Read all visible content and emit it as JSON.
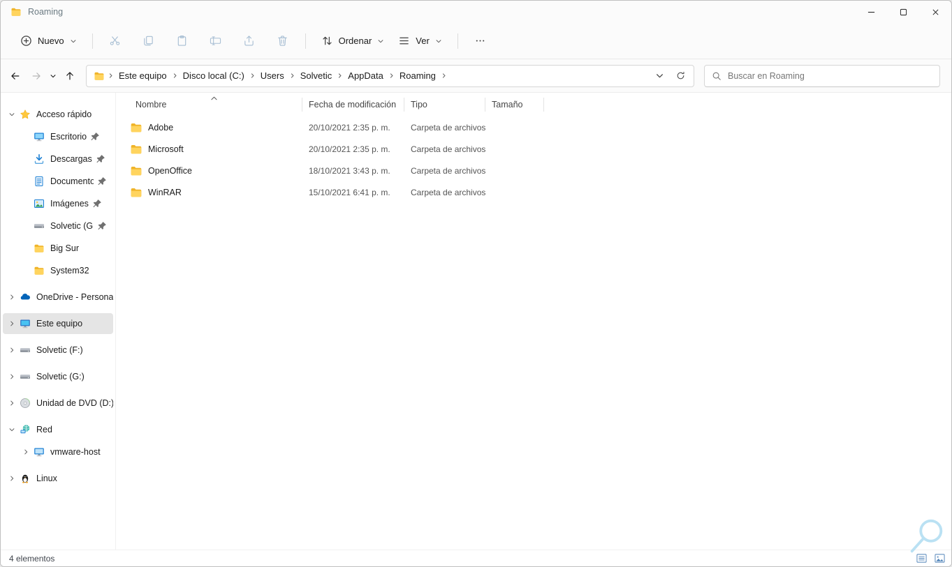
{
  "window": {
    "title": "Roaming"
  },
  "toolbar": {
    "new_label": "Nuevo",
    "actions": [
      "cut",
      "copy",
      "paste",
      "rename",
      "share",
      "delete"
    ],
    "sort_label": "Ordenar",
    "view_label": "Ver"
  },
  "navigation": {
    "breadcrumb": [
      "Este equipo",
      "Disco local (C:)",
      "Users",
      "Solvetic",
      "AppData",
      "Roaming"
    ],
    "search_placeholder": "Buscar en Roaming"
  },
  "sidebar": {
    "items": [
      {
        "label": "Acceso rápido",
        "icon": "star",
        "level": 0,
        "chevron": "down"
      },
      {
        "label": "Escritorio",
        "icon": "desktop",
        "level": 1,
        "pinned": true
      },
      {
        "label": "Descargas",
        "icon": "downloads",
        "level": 1,
        "pinned": true
      },
      {
        "label": "Documentos",
        "icon": "documents",
        "level": 1,
        "pinned": true
      },
      {
        "label": "Imágenes",
        "icon": "pictures",
        "level": 1,
        "pinned": true
      },
      {
        "label": "Solvetic (G:)",
        "icon": "drive",
        "level": 1,
        "pinned": true
      },
      {
        "label": "Big Sur",
        "icon": "folder",
        "level": 1
      },
      {
        "label": "System32",
        "icon": "folder",
        "level": 1
      },
      {
        "label": "OneDrive - Personal",
        "icon": "onedrive",
        "level": 0,
        "chevron": "right"
      },
      {
        "label": "Este equipo",
        "icon": "computer",
        "level": 0,
        "chevron": "right",
        "selected": true
      },
      {
        "label": "Solvetic (F:)",
        "icon": "drive",
        "level": 0,
        "chevron": "right"
      },
      {
        "label": "Solvetic (G:)",
        "icon": "drive",
        "level": 0,
        "chevron": "right"
      },
      {
        "label": "Unidad de DVD (D:)",
        "icon": "dvd",
        "level": 0,
        "chevron": "right"
      },
      {
        "label": "Red",
        "icon": "network",
        "level": 0,
        "chevron": "down"
      },
      {
        "label": "vmware-host",
        "icon": "monitor",
        "level": 1,
        "chevron": "right"
      },
      {
        "label": "Linux",
        "icon": "linux",
        "level": 0,
        "chevron": "right"
      }
    ]
  },
  "list": {
    "columns": [
      "Nombre",
      "Fecha de modificación",
      "Tipo",
      "Tamaño"
    ],
    "sort": {
      "column": "Nombre",
      "direction": "asc"
    },
    "rows": [
      {
        "name": "Adobe",
        "modified": "20/10/2021 2:35 p. m.",
        "type": "Carpeta de archivos",
        "size": ""
      },
      {
        "name": "Microsoft",
        "modified": "20/10/2021 2:35 p. m.",
        "type": "Carpeta de archivos",
        "size": ""
      },
      {
        "name": "OpenOffice",
        "modified": "18/10/2021 3:43 p. m.",
        "type": "Carpeta de archivos",
        "size": ""
      },
      {
        "name": "WinRAR",
        "modified": "15/10/2021 6:41 p. m.",
        "type": "Carpeta de archivos",
        "size": ""
      }
    ]
  },
  "statusbar": {
    "items_count": "4 elementos"
  },
  "colors": {
    "accent": "#0067c0",
    "folder_yellow": "#ffd45e",
    "chrome_bg": "#fbfbfb"
  }
}
